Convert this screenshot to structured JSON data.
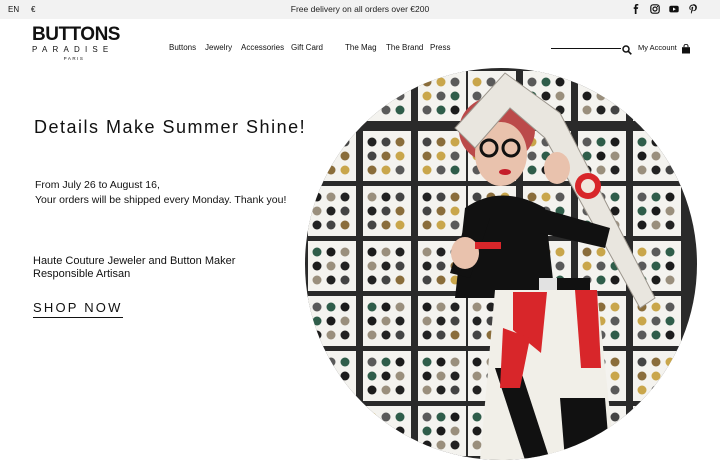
{
  "topbar": {
    "language": "EN",
    "currency": "€",
    "promo": "Free delivery on all orders over €200",
    "social_icons": [
      "facebook-icon",
      "instagram-icon",
      "youtube-icon",
      "pinterest-icon"
    ]
  },
  "logo": {
    "line1": "BUTTONS",
    "line2": "PARADISE",
    "line3": "PARIS"
  },
  "nav": {
    "items": [
      "Buttons",
      "Jewelry",
      "Accessories",
      "Gift Card",
      "The Mag",
      "The Brand",
      "Press"
    ]
  },
  "header_right": {
    "search_placeholder": "",
    "account_label": "My Account"
  },
  "hero": {
    "headline": "Details Make Summer Shine!",
    "dates_line1": "From July 26 to August 16,",
    "dates_line2": "Your orders will be shipped every Monday. Thank you!",
    "tagline_line1": "Haute Couture Jeweler and Button Maker",
    "tagline_line2": "Responsible Artisan",
    "cta": "SHOP NOW"
  },
  "colors": {
    "topbar_bg": "#f2f2f2",
    "text": "#111111",
    "accent_red": "#d8262a"
  }
}
